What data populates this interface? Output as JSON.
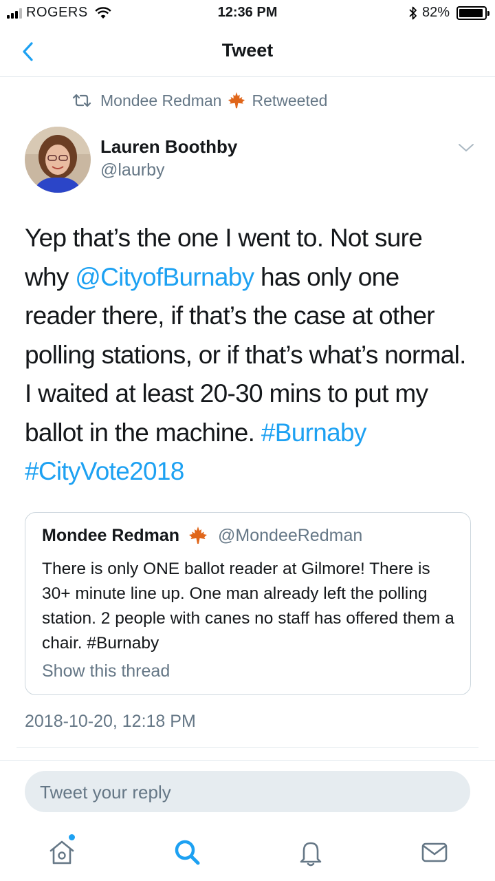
{
  "status_bar": {
    "carrier": "ROGERS",
    "time": "12:36 PM",
    "battery": "82%",
    "battery_level": 0.82
  },
  "header": {
    "title": "Tweet"
  },
  "retweet": {
    "retweeter": "Mondee Redman",
    "action": "Retweeted"
  },
  "tweet": {
    "author_name": "Lauren Boothby",
    "author_handle": "@laurby",
    "text_1": "Yep that’s the one I went to.  Not sure why ",
    "mention": "@CityofBurnaby",
    "text_2": " has only one reader there, if that’s the case at other polling stations, or if that’s what’s normal. I waited at least 20-30 mins to put my ballot in the machine. ",
    "hashtag_1": "#Burnaby",
    "hashtag_2": "#CityVote2018",
    "timestamp": "2018-10-20, 12:18 PM"
  },
  "quoted_tweet": {
    "author_name": "Mondee Redman",
    "author_handle": "@MondeeRedman",
    "text": "There is only ONE ballot reader at Gilmore! There is 30+ minute line up. One man already left the polling station. 2 people with canes no staff has offered them a chair. #Burnaby",
    "show_thread": "Show this thread"
  },
  "reply": {
    "placeholder": "Tweet your reply"
  },
  "tabs": [
    {
      "icon": "home-icon",
      "active": false,
      "has_notification": true
    },
    {
      "icon": "search-icon",
      "active": true,
      "has_notification": false
    },
    {
      "icon": "bell-icon",
      "active": false,
      "has_notification": false
    },
    {
      "icon": "mail-icon",
      "active": false,
      "has_notification": false
    }
  ],
  "colors": {
    "accent": "#1da1f2",
    "secondary_text": "#657786",
    "primary_text": "#14171a",
    "maple_leaf": "#e0661a"
  }
}
